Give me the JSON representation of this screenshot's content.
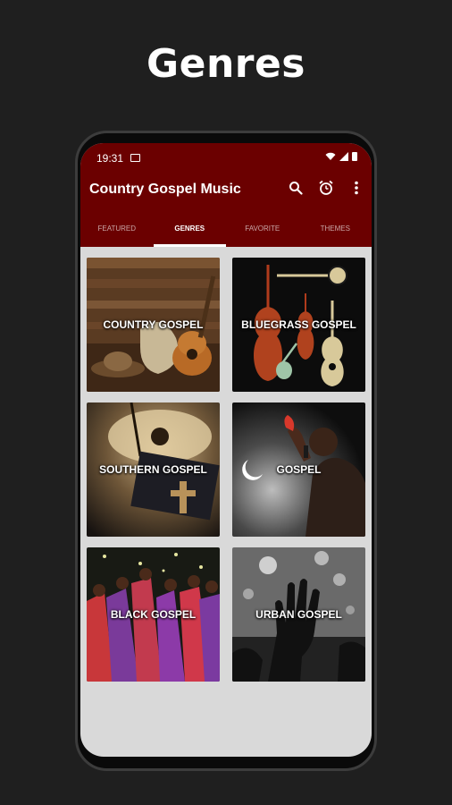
{
  "headline": "Genres",
  "status": {
    "time": "19:31"
  },
  "app": {
    "title": "Country Gospel Music"
  },
  "actions": {
    "search": "search-icon",
    "alarm": "alarm-icon",
    "more": "more-vert-icon"
  },
  "tabs": [
    {
      "label": "FEATURED"
    },
    {
      "label": "GENRES"
    },
    {
      "label": "FAVORITE"
    },
    {
      "label": "THEMES"
    }
  ],
  "active_tab": "GENRES",
  "colors": {
    "appbar": "#6b0000",
    "background": "#1f1f1f",
    "content": "#d9d9d9"
  },
  "genres": [
    {
      "label": "COUNTRY GOSPEL"
    },
    {
      "label": "BLUEGRASS GOSPEL"
    },
    {
      "label": "SOUTHERN GOSPEL"
    },
    {
      "label": "GOSPEL"
    },
    {
      "label": "BLACK GOSPEL"
    },
    {
      "label": "URBAN GOSPEL"
    }
  ]
}
